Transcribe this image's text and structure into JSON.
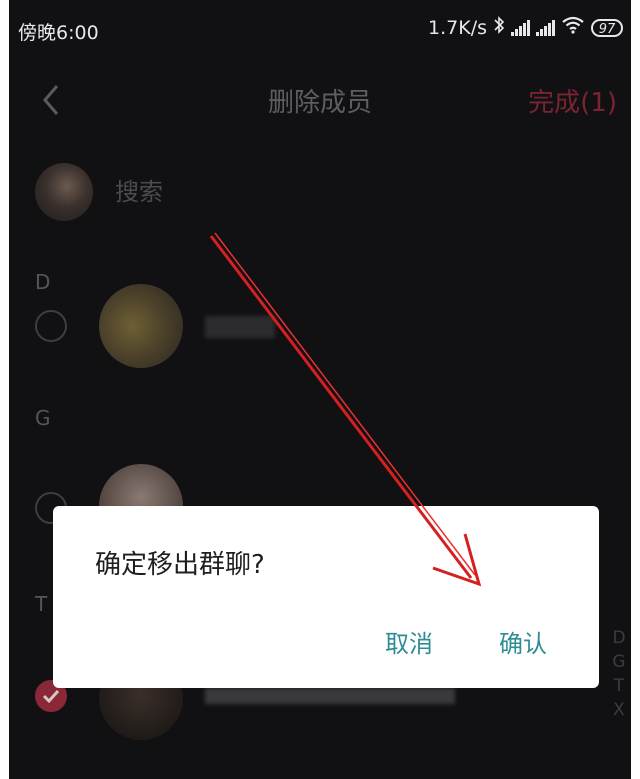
{
  "status": {
    "time": "傍晚6:00",
    "network_speed": "1.7K/s",
    "battery": "97"
  },
  "header": {
    "title": "删除成员",
    "done_label": "完成(1)"
  },
  "search": {
    "placeholder": "搜索"
  },
  "sections": [
    "D",
    "G",
    "T"
  ],
  "index_letters": [
    "D",
    "G",
    "T",
    "X"
  ],
  "dialog": {
    "message": "确定移出群聊?",
    "cancel_label": "取消",
    "confirm_label": "确认"
  },
  "colors": {
    "background": "#111114",
    "accent_red": "#8a2838",
    "dialog_button": "#2e8d94"
  }
}
